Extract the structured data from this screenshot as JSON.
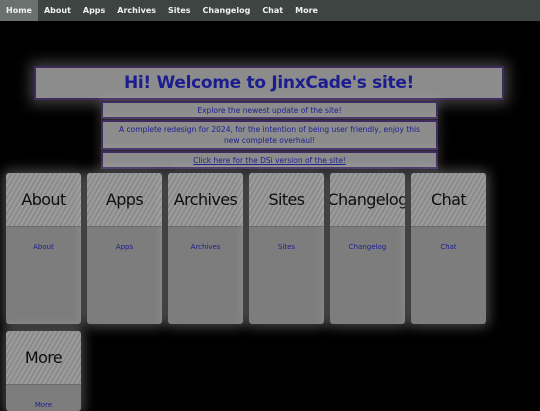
{
  "nav": {
    "items": [
      {
        "label": "Home",
        "active": true
      },
      {
        "label": "About"
      },
      {
        "label": "Apps"
      },
      {
        "label": "Archives"
      },
      {
        "label": "Sites"
      },
      {
        "label": "Changelog"
      },
      {
        "label": "Chat"
      },
      {
        "label": "More"
      }
    ]
  },
  "banner": {
    "title": "Hi! Welcome to JinxCade's site!"
  },
  "info": {
    "line1": "Explore the newest update of the site!",
    "line2": "A complete redesign for 2024, for the intention of being user friendly, enjoy this new complete overhaul!",
    "dsi_link": "Click here for the DSi version of the site!"
  },
  "cards": [
    {
      "title": "About",
      "link": "About"
    },
    {
      "title": "Apps",
      "link": "Apps"
    },
    {
      "title": "Archives",
      "link": "Archives"
    },
    {
      "title": "Sites",
      "link": "Sites"
    },
    {
      "title": "Changelog",
      "link": "Changelog"
    },
    {
      "title": "Chat",
      "link": "Chat"
    },
    {
      "title": "More",
      "link": "More"
    }
  ],
  "colors": {
    "background": "#000000",
    "nav_bg": "#3e4442",
    "nav_active": "#6b716f",
    "panel_bg": "#8c8c8c",
    "panel_border": "#3f2a5e",
    "link_text": "#1b1d8f"
  }
}
